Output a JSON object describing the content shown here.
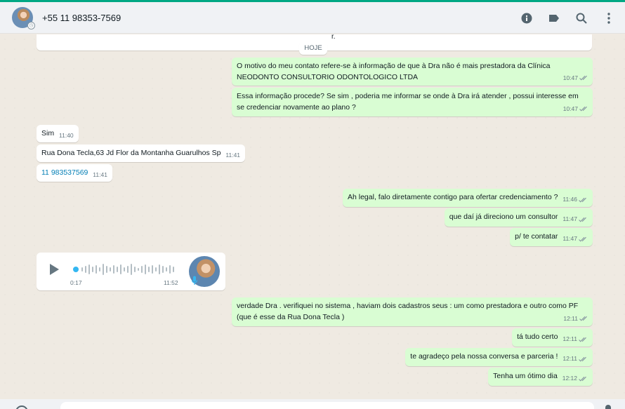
{
  "header": {
    "contact_name": "+55 11 98353-7569",
    "icons": [
      "info-icon",
      "label-icon",
      "search-icon",
      "menu-icon"
    ]
  },
  "chat": {
    "previous_card_text": "r.",
    "date_separator": "HOJE",
    "messages": [
      {
        "direction": "out",
        "text": "O motivo do meu contato refere-se à informação de que à Dra não é mais prestadora da Clínica NEODONTO CONSULTORIO ODONTOLOGICO LTDA",
        "time": "10:47"
      },
      {
        "direction": "out",
        "text": "Essa informação procede? Se sim , poderia me informar se onde à Dra irá atender , possui interesse em se credenciar novamente ao plano ?",
        "time": "10:47"
      },
      {
        "direction": "in",
        "text": "Sim",
        "time": "11:40"
      },
      {
        "direction": "in",
        "text": "Rua Dona Tecla,63 Jd Flor da Montanha Guarulhos Sp",
        "time": "11:41"
      },
      {
        "direction": "in",
        "text": "11 983537569",
        "time": "11:41"
      },
      {
        "direction": "out",
        "text": "Ah legal, falo diretamente contigo para ofertar credenciamento ?",
        "time": "11:46"
      },
      {
        "direction": "out",
        "text": "que daí já direciono um consultor",
        "time": "11:47"
      },
      {
        "direction": "out",
        "text": "p/ te contatar",
        "time": "11:47"
      },
      {
        "direction": "out",
        "text": "verdade Dra . verifiquei no sistema , haviam dois cadastros seus : um como prestadora e outro como PF (que é esse da Rua Dona Tecla )",
        "time": "12:11"
      },
      {
        "direction": "out",
        "text": "tá tudo certo",
        "time": "12:11"
      },
      {
        "direction": "out",
        "text": "te agradeço pela nossa conversa e parceria !",
        "time": "12:11"
      },
      {
        "direction": "out",
        "text": "Tenha um ótimo dia",
        "time": "12:12"
      }
    ],
    "audio": {
      "duration": "0:17",
      "time": "11:52"
    }
  },
  "colors": {
    "accent": "#00a884",
    "outgoing_bubble": "#d9fdd3",
    "incoming_bubble": "#ffffff",
    "read_ticks": "#8696a0",
    "link": "#027eb5"
  }
}
